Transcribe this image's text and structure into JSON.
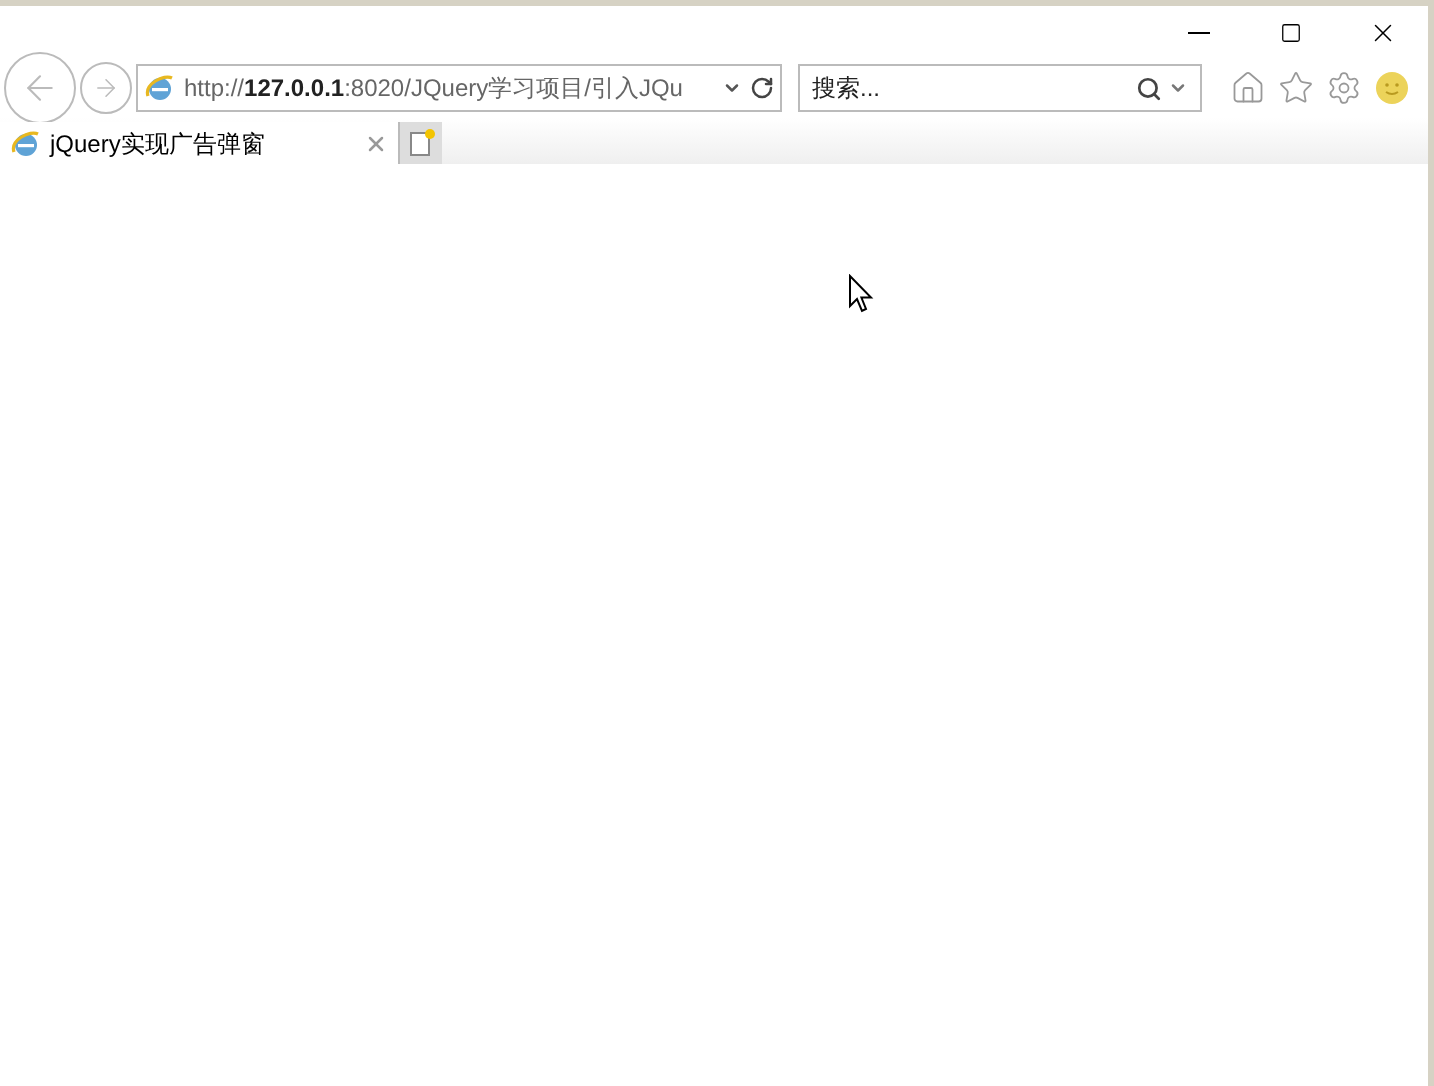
{
  "address_bar": {
    "value": "http://**127.0.0.1**:8020/JQuery学习项目/引入JQu"
  },
  "search": {
    "placeholder": "搜索..."
  },
  "tabs": [
    {
      "label": "jQuery实现广告弹窗",
      "selected": true
    }
  ]
}
